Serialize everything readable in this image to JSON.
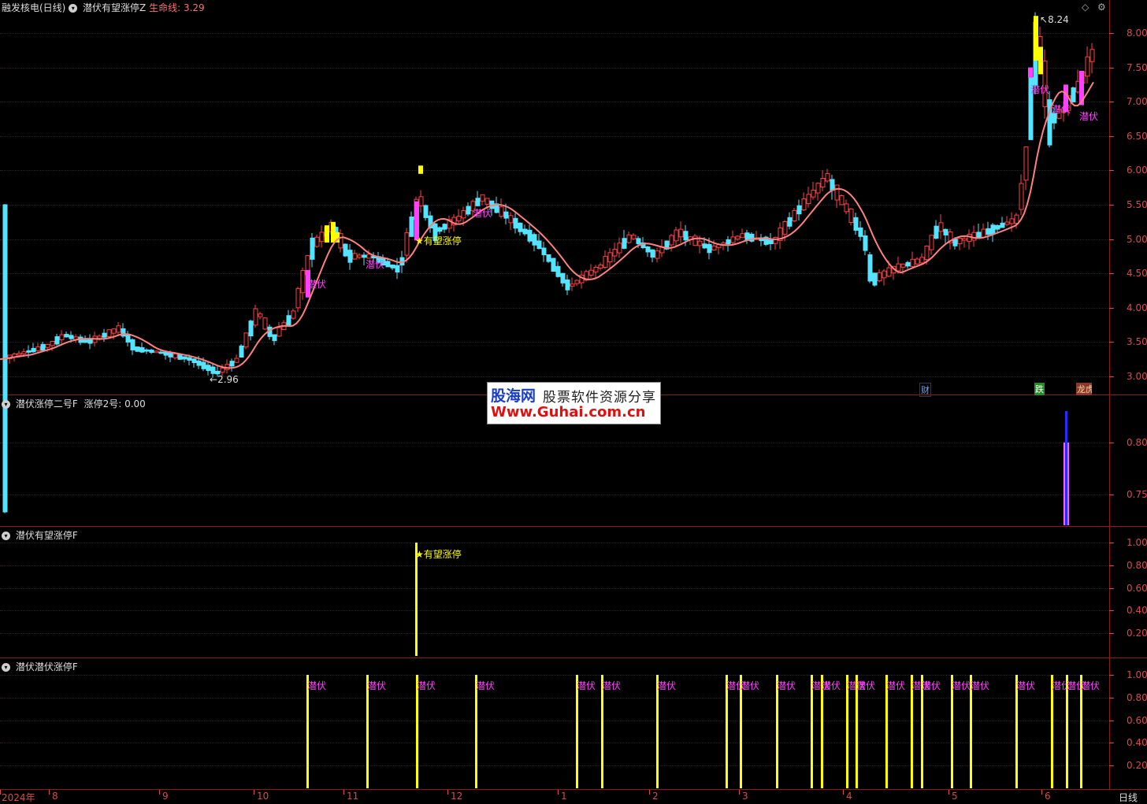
{
  "main_panel": {
    "stock_name": "融发核电(日线)",
    "indicator_name": "潜伏有望涨停Z",
    "lifeline_label": "生命线:",
    "lifeline_value": "3.29",
    "yticks": [
      "8.00",
      "7.50",
      "7.00",
      "6.50",
      "6.00",
      "5.50",
      "5.00",
      "4.50",
      "4.00",
      "3.50",
      "3.00"
    ],
    "high_label": "8.24",
    "low_label": "2.96",
    "signal_label": "潜伏",
    "star_label": "有望涨停",
    "events": {
      "cai": "财",
      "die": "跌",
      "bang": "龙虎榜"
    },
    "colors": {
      "up": "#ff4040",
      "down": "#54e4ff",
      "ma": "#ff8080",
      "signal": "#ff40ff",
      "star": "#ffff00"
    }
  },
  "panel2": {
    "title": "潜伏涨停二号F",
    "value_label": "涨停2号:",
    "value": "0.00",
    "yticks": [
      "0.80",
      "0.75"
    ]
  },
  "panel3": {
    "title": "潜伏有望涨停F",
    "signal_label": "★有望涨停",
    "yticks": [
      "1.00",
      "0.80",
      "0.60",
      "0.40",
      "0.20"
    ]
  },
  "panel4": {
    "title": "潜伏潜伏涨停F",
    "signal_label": "潜伏",
    "yticks": [
      "1.00",
      "0.80",
      "0.60",
      "0.40",
      "0.20"
    ]
  },
  "xaxis": {
    "labels": [
      "2024年",
      "8",
      "9",
      "10",
      "11",
      "12",
      "1",
      "2",
      "3",
      "4",
      "5",
      "6"
    ],
    "period": "日线"
  },
  "watermark": {
    "brand": "股海网",
    "slogan": "股票软件资源分享",
    "url": "Www.Guhai.com.cn"
  },
  "top_icons": [
    "diamond-icon",
    "tool-icon"
  ]
}
